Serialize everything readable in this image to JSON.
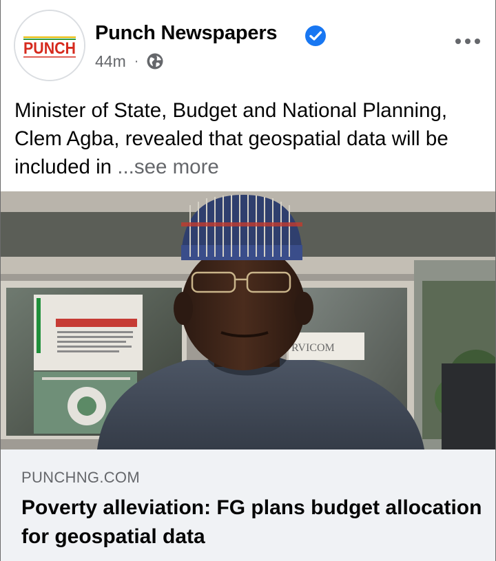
{
  "post": {
    "page_name": "Punch Newspapers",
    "avatar_text": "PUNCH",
    "timestamp": "44m",
    "separator": "·",
    "audience_icon": "globe-icon",
    "verified_icon": "verified-badge-icon",
    "more_icon": "more-options-icon",
    "text": "Minister of State, Budget and National Planning, Clem Agba, revealed that geospatial data will be included in ",
    "see_more": "...see more",
    "photo_sign_text": "RVICOM"
  },
  "link_card": {
    "domain": "PUNCHNG.COM",
    "title": "Poverty alleviation: FG plans budget allocation for geospatial data"
  },
  "colors": {
    "verified_blue": "#1877f2",
    "secondary_text": "#65676b",
    "primary_text": "#050505",
    "card_background": "#f0f2f5",
    "punch_red": "#d62a1e"
  }
}
